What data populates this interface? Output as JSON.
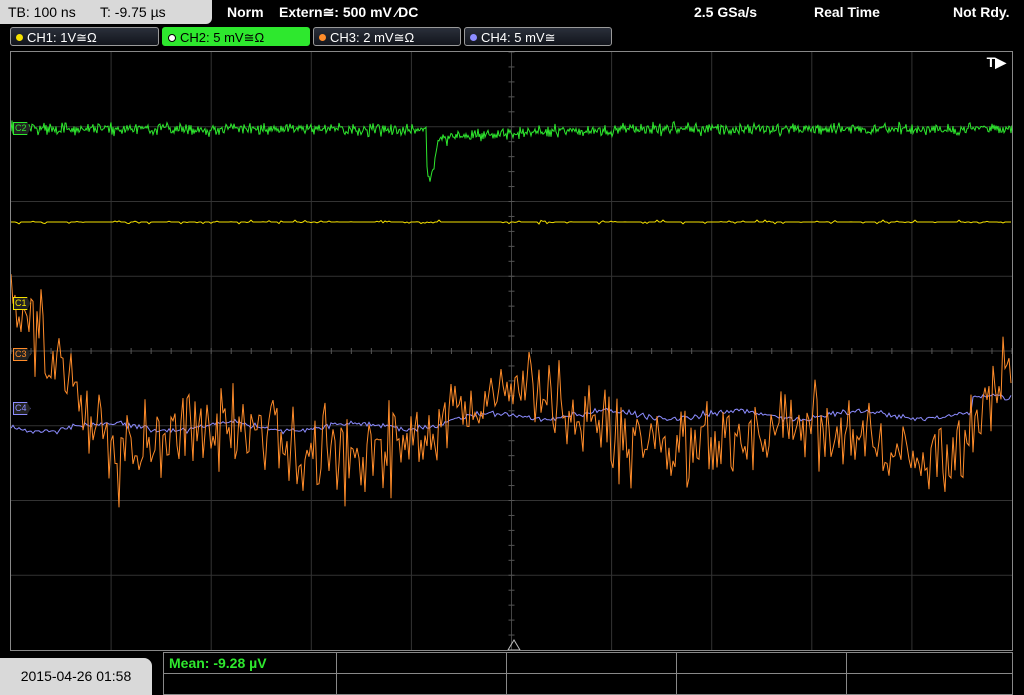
{
  "header": {
    "timebase": "TB: 100 ns",
    "trigger_time": "T: -9.75 µs",
    "trigger_mode": "Norm",
    "trigger_source": "Extern≅: 500 mV ⁄DC",
    "sample_rate": "2.5 GSa/s",
    "acq_mode": "Real Time",
    "status": "Not Rdy."
  },
  "channels": [
    {
      "label": "CH1: 1V≅Ω",
      "color": "#f5e100",
      "active": false
    },
    {
      "label": "CH2: 5 mV≅Ω",
      "color": "#2ee82e",
      "active": true
    },
    {
      "label": "CH3: 2 mV≅Ω",
      "color": "#ff8c2a",
      "active": false
    },
    {
      "label": "CH4: 5 mV≅",
      "color": "#8c8cff",
      "active": false
    }
  ],
  "markers": {
    "ch1": "C1",
    "ch2": "C2",
    "ch3": "C3",
    "ch4": "C4",
    "trigger": "T▶"
  },
  "footer": {
    "datetime": "2015-04-26 01:58",
    "measurement": "Mean: -9.28 µV"
  },
  "icons": {
    "channel_dot": "circle-icon",
    "trigger_arrow": "trigger-arrow-icon"
  }
}
